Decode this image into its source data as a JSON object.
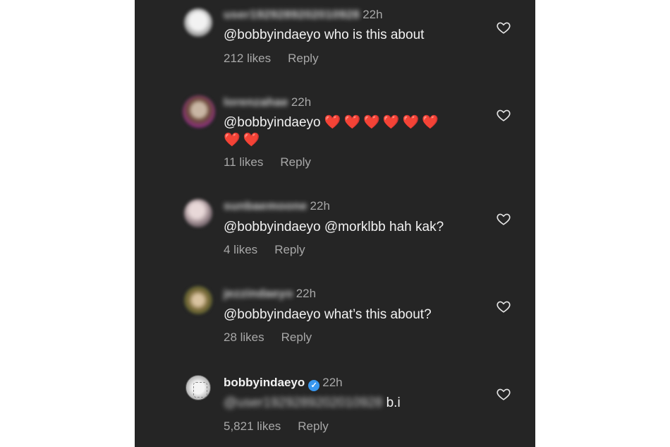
{
  "comments": [
    {
      "username": "user1929289202010928",
      "time": "22h",
      "text": "@bobbyindaeyo who is this about",
      "likes": "212 likes",
      "reply": "Reply"
    },
    {
      "username": "lorenzahae",
      "time": "22h",
      "text": "@bobbyindaeyo",
      "hearts": "❤️❤️❤️❤️❤️❤️ ❤️❤️",
      "likes": "11 likes",
      "reply": "Reply"
    },
    {
      "username": "sunbaemoone",
      "time": "22h",
      "text": "@bobbyindaeyo @morklbb hah kak?",
      "likes": "4 likes",
      "reply": "Reply"
    },
    {
      "username": "jezzindaeyo",
      "time": "22h",
      "text": "@bobbyindaeyo what’s this about?",
      "likes": "28 likes",
      "reply": "Reply"
    },
    {
      "username": "bobbyindaeyo",
      "verified_badge": "✓",
      "time": "22h",
      "mention": "@user1929289202010928",
      "text": "b.i",
      "likes": "5,821 likes",
      "reply": "Reply"
    }
  ],
  "icons": {
    "like": "heart-outline-icon"
  },
  "colors": {
    "panel_bg": "#252525",
    "verified": "#3897f0",
    "heart": "#e0283a"
  }
}
